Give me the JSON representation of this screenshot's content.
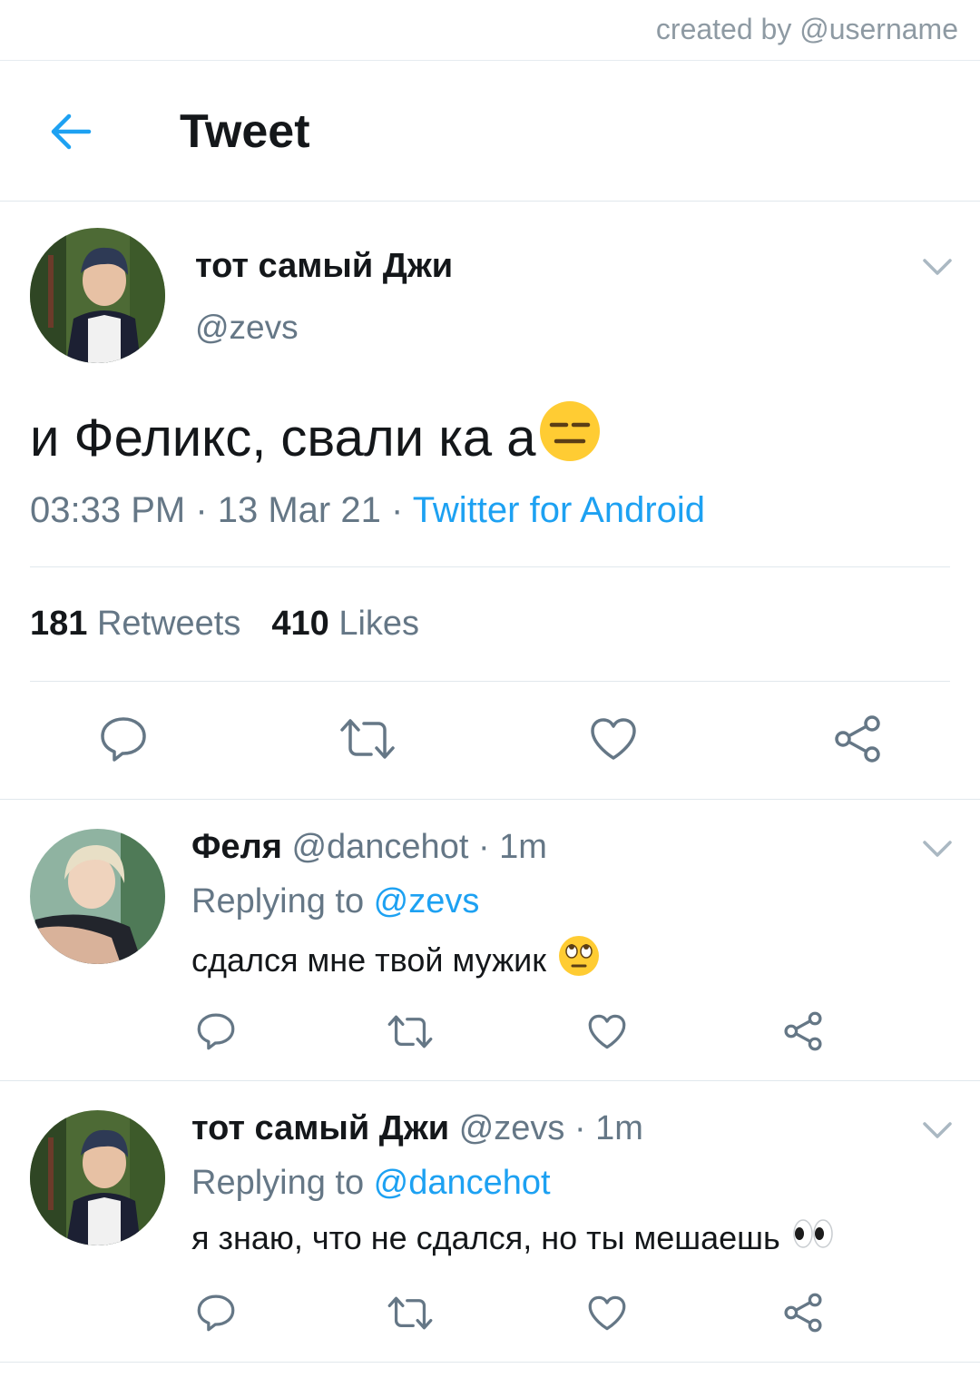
{
  "credit": "created by @username",
  "header": {
    "title": "Tweet"
  },
  "tweet": {
    "name": "тот самый Джи",
    "handle": "@zevs",
    "text": "и Феликс, свали ка а",
    "time": "03:33 PM · 13 Mar 21 · ",
    "source": "Twitter for Android",
    "retweets_count": "181",
    "retweets_label": " Retweets",
    "likes_count": "410",
    "likes_label": " Likes"
  },
  "replies": [
    {
      "name": "Феля",
      "handle": " @dancehot · 1m",
      "replying_label": "Replying to ",
      "replying_to": "@zevs",
      "text": "сдался мне твой мужик"
    },
    {
      "name": "тот самый Джи",
      "handle": " @zevs · 1m",
      "replying_label": "Replying to ",
      "replying_to": "@dancehot",
      "text": "я знаю, что не сдался, но ты мешаешь"
    }
  ],
  "colors": {
    "accent": "#1da1f2",
    "muted": "#657786",
    "text": "#14171a",
    "divider": "#e1e8ed"
  },
  "icons": [
    "back-arrow-icon",
    "chevron-down-icon",
    "reply-icon",
    "retweet-icon",
    "like-icon",
    "share-icon",
    "expressionless-emoji-icon",
    "eye-roll-emoji-icon",
    "eyes-emoji-icon"
  ]
}
